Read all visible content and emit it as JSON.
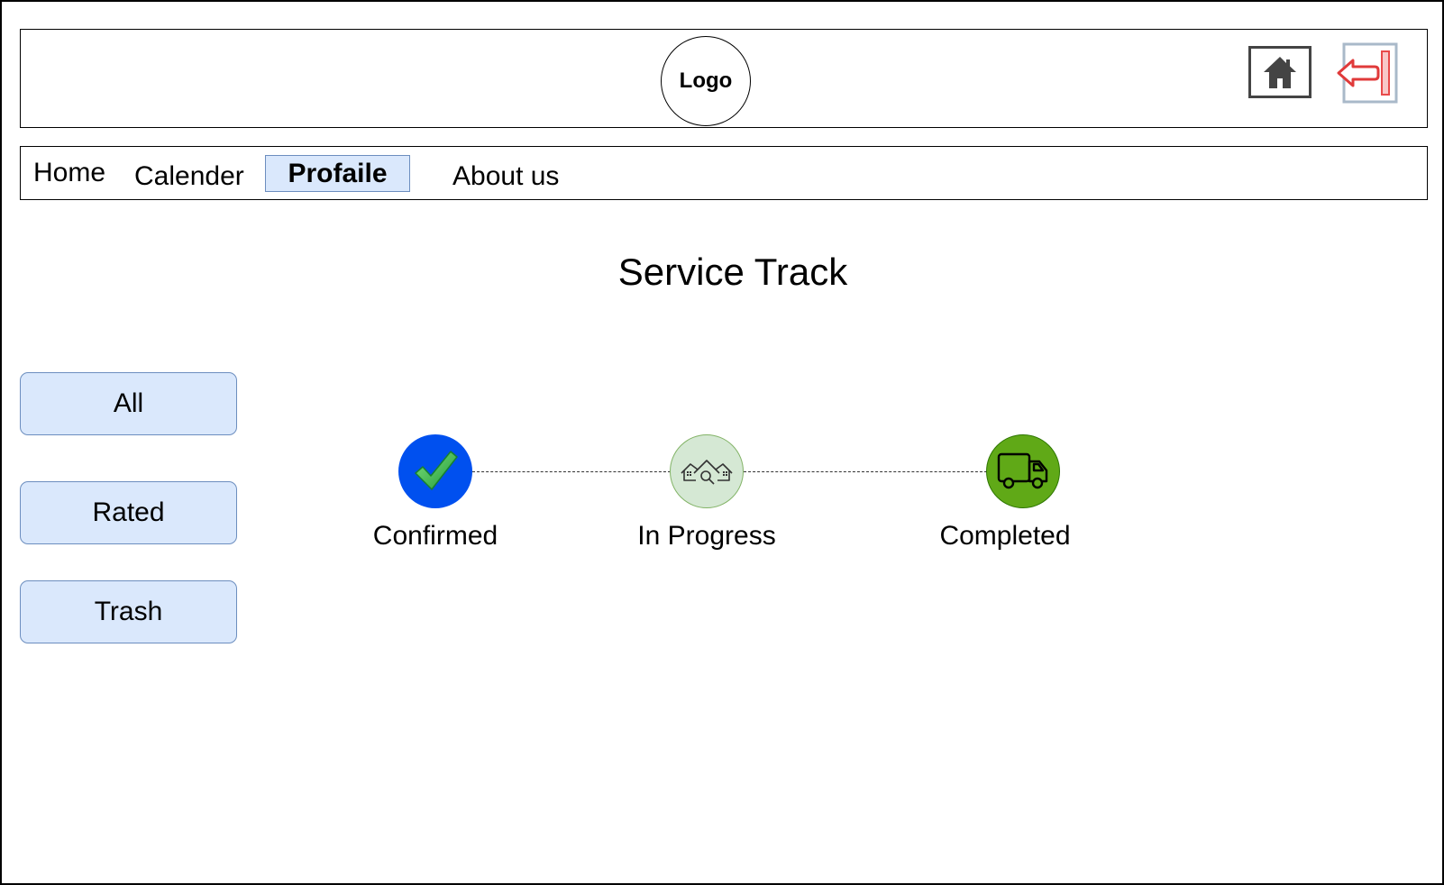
{
  "header": {
    "logo_text": "Logo",
    "home_icon": "home-icon",
    "logout_icon": "logout-icon"
  },
  "nav": {
    "items": [
      {
        "label": "Home"
      },
      {
        "label": "Calender"
      },
      {
        "label": "Profaile",
        "active": true
      },
      {
        "label": "About us"
      }
    ]
  },
  "main": {
    "title": "Service Track"
  },
  "sidebar": {
    "filters": [
      {
        "label": "All"
      },
      {
        "label": "Rated"
      },
      {
        "label": "Trash"
      }
    ]
  },
  "tracker": {
    "steps": [
      {
        "label": "Confirmed",
        "icon": "checkmark-icon",
        "color": "#0050ef"
      },
      {
        "label": "In Progress",
        "icon": "house-inspection-icon",
        "color": "#d5e8d4"
      },
      {
        "label": "Completed",
        "icon": "delivery-truck-icon",
        "color": "#60a917"
      }
    ]
  },
  "colors": {
    "button_fill": "#dae8fc",
    "button_border": "#6c8ebf"
  }
}
